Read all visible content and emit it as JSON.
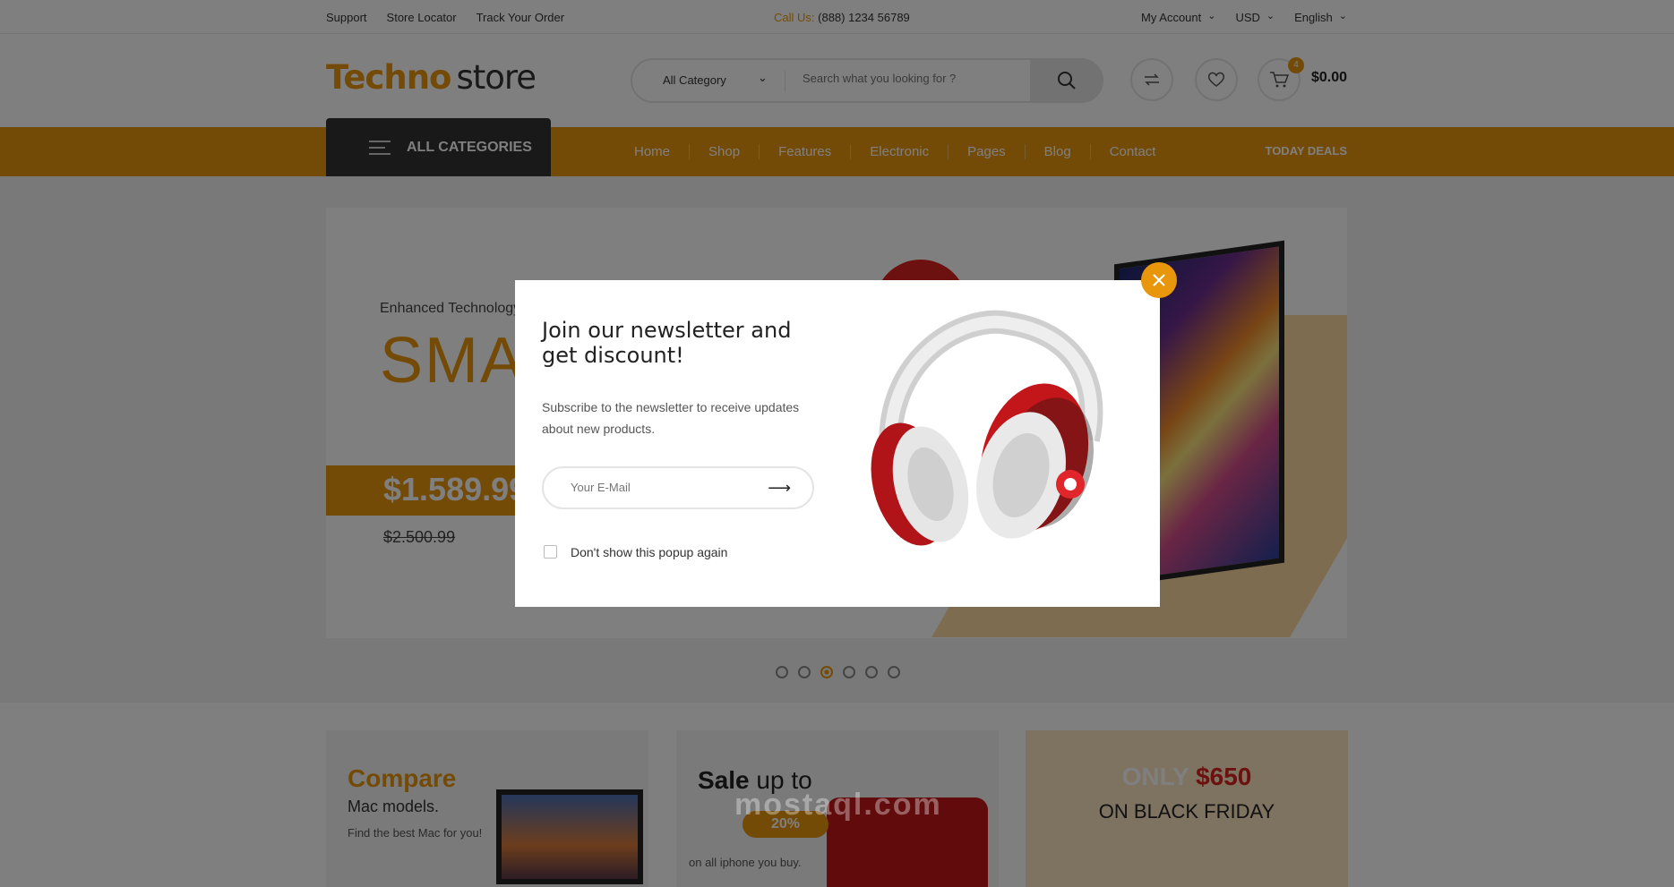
{
  "topbar": {
    "links": [
      "Support",
      "Store Locator",
      "Track Your Order"
    ],
    "call_label": "Call Us:",
    "phone": "(888) 1234 56789",
    "account": "My Account",
    "currency": "USD",
    "language": "English"
  },
  "header": {
    "logo_a": "Techno",
    "logo_b": "store",
    "category_select": "All Category",
    "search_placeholder": "Search what you looking for ?",
    "cart_count": "4",
    "cart_total": "$0.00"
  },
  "nav": {
    "all_categories": "ALL CATEGORIES",
    "items": [
      "Home",
      "Shop",
      "Features",
      "Electronic",
      "Pages",
      "Blog",
      "Contact"
    ],
    "deals": "TODAY DEALS"
  },
  "hero": {
    "tagline": "Enhanced Technology",
    "headline": "SMA",
    "price": "$1.589.99",
    "old_price": "$2.500.99",
    "slide_count": 6,
    "active_slide": 3
  },
  "promos": {
    "compare_title": "Compare",
    "compare_sub": "Mac models.",
    "compare_desc": "Find the best Mac for you!",
    "sale_title": "Sale",
    "sale_rest": "up to",
    "sale_badge": "20%",
    "sale_desc": "on all iphone you buy.",
    "bf_only": "ONLY",
    "bf_price": "$650",
    "bf_sub": "ON BLACK FRIDAY"
  },
  "popup": {
    "title": "Join our newsletter and get discount!",
    "description": "Subscribe to the newsletter to receive updates about new products.",
    "email_placeholder": "Your E-Mail",
    "checkbox_label": "Don't show this popup again"
  },
  "watermark": "mostaql.com",
  "colors": {
    "accent": "#e8970c",
    "dark": "#333333",
    "red": "#d8231e"
  }
}
